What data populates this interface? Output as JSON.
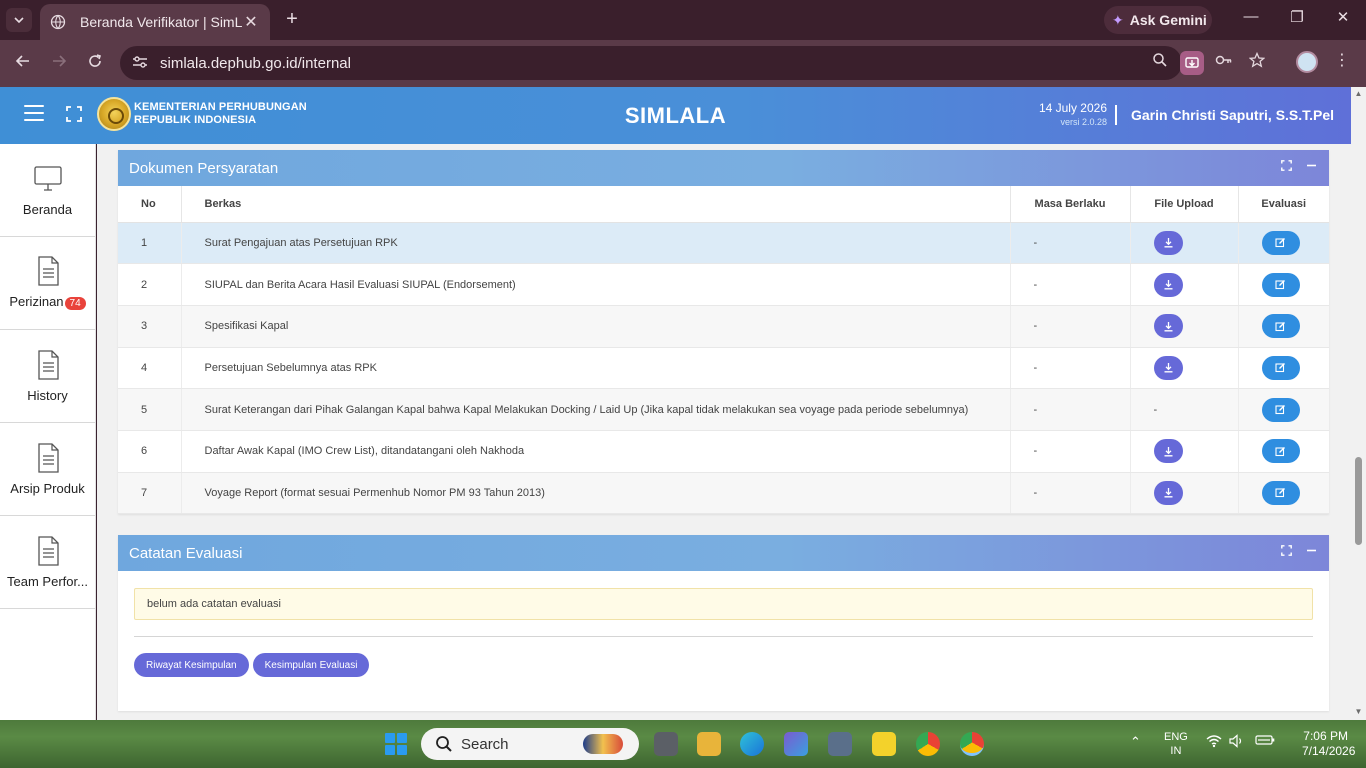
{
  "browser": {
    "tab_title": "Beranda Verifikator | SimLala",
    "tab_close": "✕",
    "new_tab": "+",
    "gemini_label": "Ask Gemini",
    "url": "simlala.dephub.go.id/internal"
  },
  "header": {
    "ministry_line1": "KEMENTERIAN PERHUBUNGAN",
    "ministry_line2": "REPUBLIK INDONESIA",
    "app_title": "SIMLALA",
    "date": "14 July 2026",
    "version": "versi 2.0.28",
    "user": "Garin Christi Saputri, S.S.T.Pel"
  },
  "sidebar": {
    "items": [
      {
        "label": "Beranda",
        "icon": "monitor-icon"
      },
      {
        "label": "Perizinan",
        "icon": "document-icon",
        "badge": "74"
      },
      {
        "label": "History",
        "icon": "document-icon"
      },
      {
        "label": "Arsip Produk",
        "icon": "document-icon"
      },
      {
        "label": "Team Perfor...",
        "icon": "document-icon"
      }
    ]
  },
  "documents": {
    "title": "Dokumen Persyaratan",
    "columns": {
      "no": "No",
      "berkas": "Berkas",
      "masa": "Masa Berlaku",
      "file": "File Upload",
      "eval": "Evaluasi"
    },
    "rows": [
      {
        "no": "1",
        "berkas": "Surat Pengajuan atas Persetujuan RPK",
        "masa": "-",
        "file": "download",
        "eval": "edit"
      },
      {
        "no": "2",
        "berkas": "SIUPAL dan Berita Acara Hasil Evaluasi SIUPAL (Endorsement)",
        "masa": "-",
        "file": "download",
        "eval": "edit"
      },
      {
        "no": "3",
        "berkas": "Spesifikasi Kapal",
        "masa": "-",
        "file": "download",
        "eval": "edit"
      },
      {
        "no": "4",
        "berkas": "Persetujuan Sebelumnya atas RPK",
        "masa": "-",
        "file": "download",
        "eval": "edit"
      },
      {
        "no": "5",
        "berkas": "Surat Keterangan dari Pihak Galangan Kapal bahwa Kapal Melakukan Docking / Laid Up (Jika kapal tidak melakukan sea voyage pada periode sebelumnya)",
        "masa": "-",
        "file": "-",
        "eval": "edit"
      },
      {
        "no": "6",
        "berkas": "Daftar Awak Kapal (IMO Crew List), ditandatangani oleh Nakhoda",
        "masa": "-",
        "file": "download",
        "eval": "edit"
      },
      {
        "no": "7",
        "berkas": "Voyage Report (format sesuai Permenhub Nomor PM 93 Tahun 2013)",
        "masa": "-",
        "file": "download",
        "eval": "edit"
      }
    ]
  },
  "evaluation": {
    "title": "Catatan Evaluasi",
    "note": "belum ada catatan evaluasi",
    "btn_history": "Riwayat Kesimpulan",
    "btn_conclusion": "Kesimpulan Evaluasi"
  },
  "taskbar": {
    "search": "Search",
    "lang1": "ENG",
    "lang2": "IN",
    "time": "7:06 PM",
    "date": "7/14/2026"
  },
  "colors": {
    "accent": "#2f8ee0",
    "purple_button": "#6669d8",
    "badge": "#e9433b"
  }
}
